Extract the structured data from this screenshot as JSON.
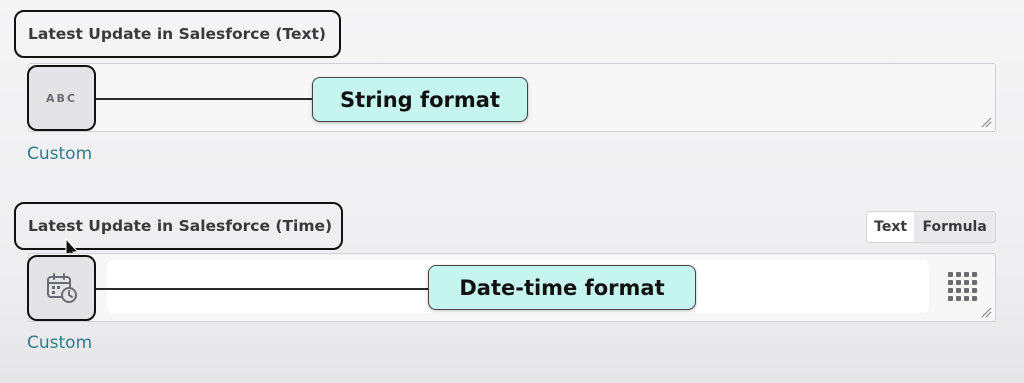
{
  "fields": [
    {
      "label": "Latest Update in Salesforce (Text)",
      "icon": "abc-icon",
      "icon_text": "ABC",
      "callout": "String format",
      "link": "Custom"
    },
    {
      "label": "Latest Update in Salesforce (Time)",
      "icon": "calendar-clock-icon",
      "callout": "Date-time format",
      "link": "Custom",
      "mode_toggle": {
        "options": [
          "Text",
          "Formula"
        ],
        "selected": "Text"
      }
    }
  ],
  "colors": {
    "callout_bg": "#c6f5f0",
    "link": "#2e7d8a",
    "outline": "#111111"
  }
}
